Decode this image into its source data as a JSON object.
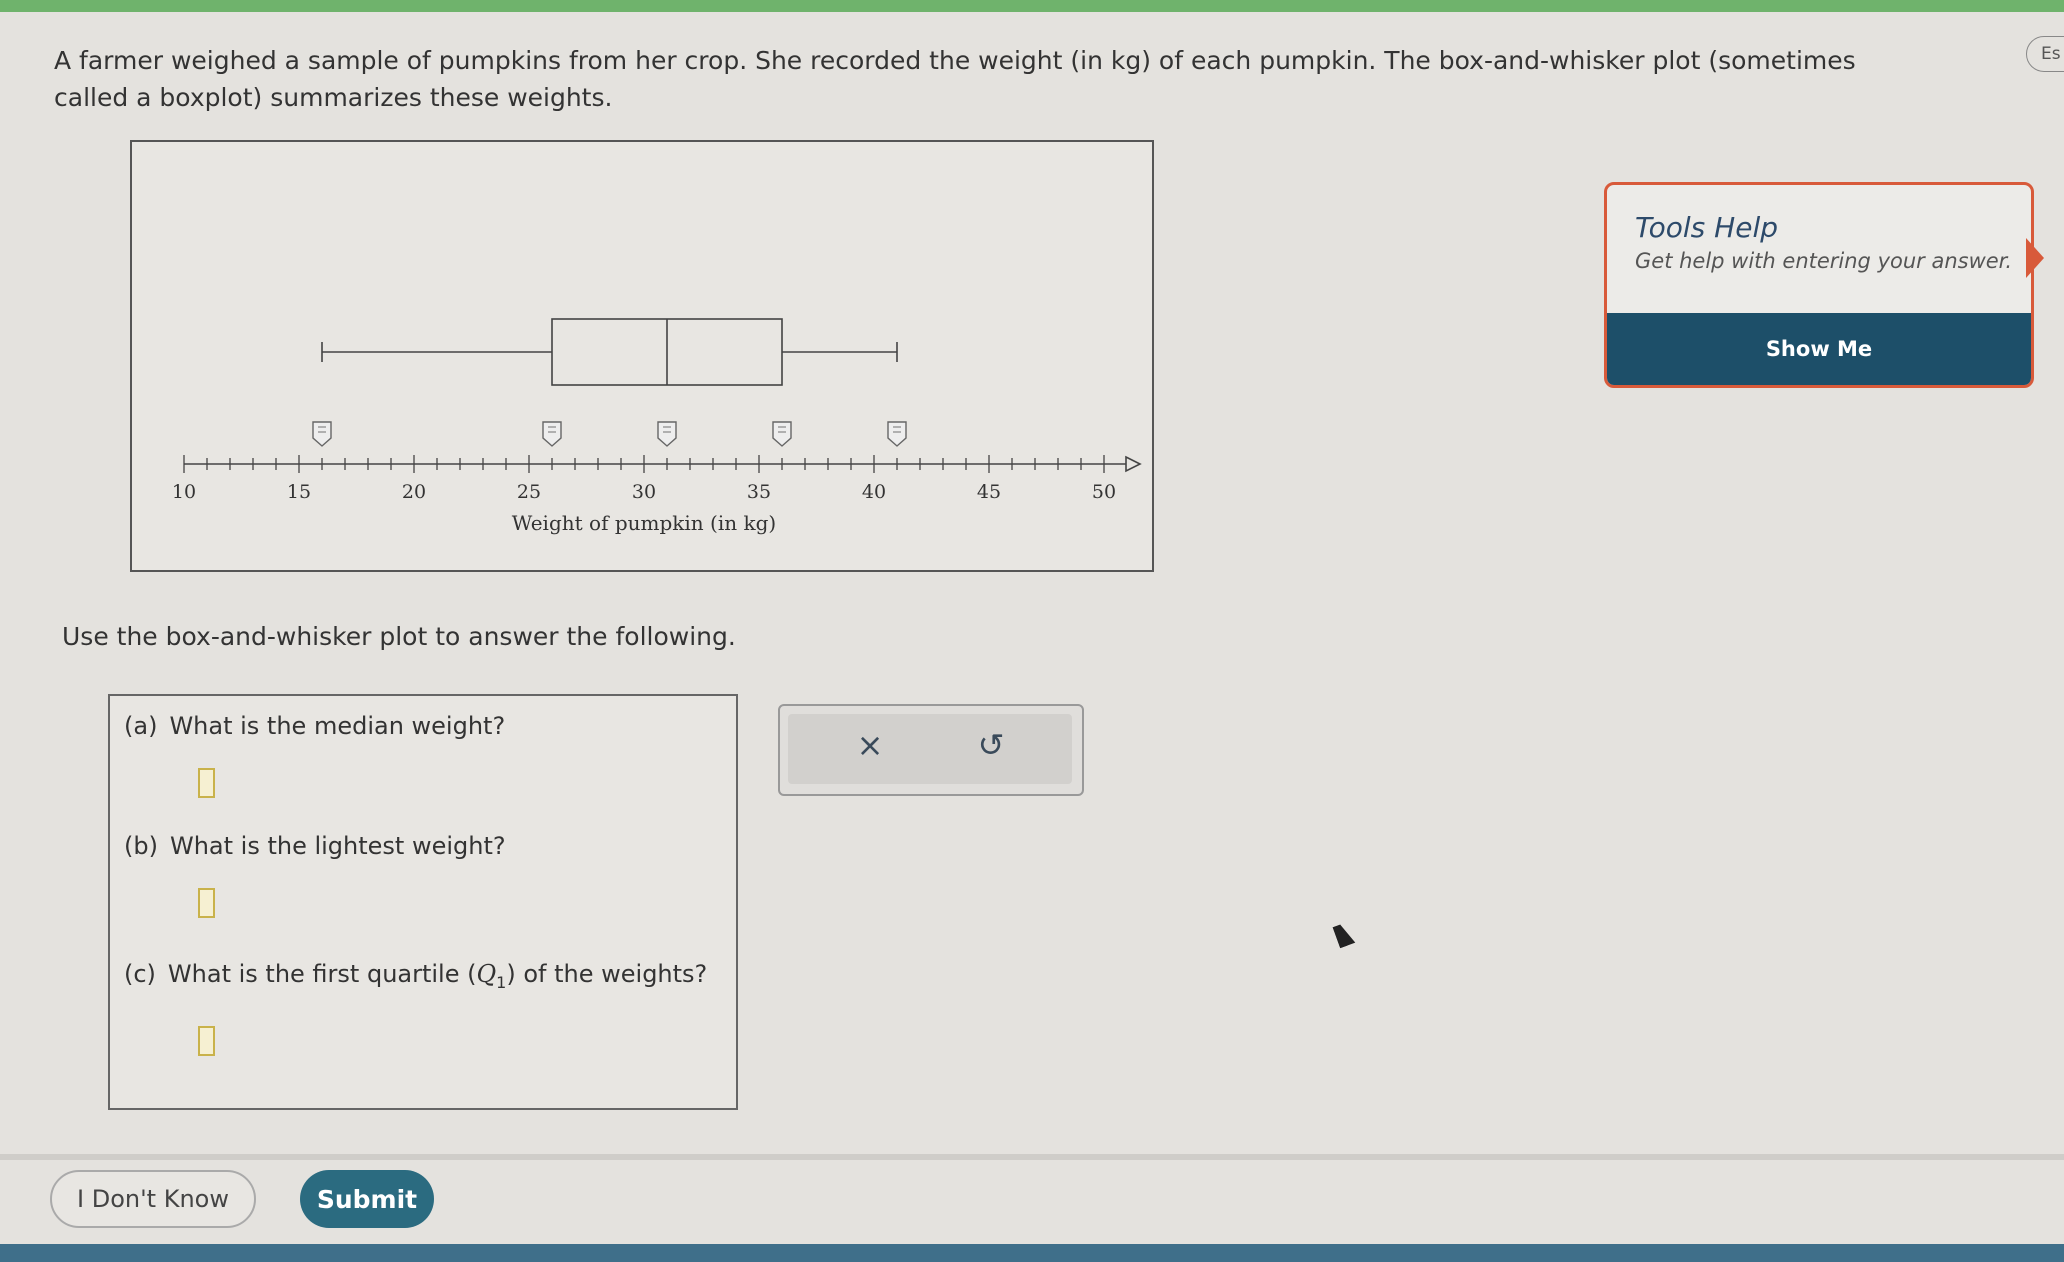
{
  "header": {
    "lang_label": "Es"
  },
  "problem": {
    "intro": "A farmer weighed a sample of pumpkins from her crop. She recorded the weight (in kg) of each pumpkin. The box-and-whisker plot (sometimes called a boxplot) summarizes these weights.",
    "instruction": "Use the box-and-whisker plot to answer the following."
  },
  "chart_data": {
    "type": "boxplot",
    "xlabel": "Weight of pumpkin (in kg)",
    "xlim": [
      10,
      50
    ],
    "ticks": [
      10,
      15,
      20,
      25,
      30,
      35,
      40,
      45,
      50
    ],
    "minor_tick_step": 1,
    "min": 16,
    "q1": 26,
    "median": 31,
    "q3": 36,
    "max": 41,
    "marker_handles_at": [
      16,
      26,
      31,
      36,
      41
    ]
  },
  "questions": [
    {
      "letter": "(a)",
      "text": "What is the median weight?",
      "value": ""
    },
    {
      "letter": "(b)",
      "text": "What is the lightest weight?",
      "value": ""
    },
    {
      "letter": "(c)",
      "text": "What is the first quartile (Q1) of the weights?",
      "text_before": "What is the first quartile (",
      "q_symbol": "Q",
      "q_sub": "1",
      "text_after": ") of the weights?",
      "value": ""
    }
  ],
  "toolbox": {
    "clear_icon": "×",
    "undo_icon": "↺"
  },
  "help": {
    "title": "Tools Help",
    "subtitle": "Get help with entering your answer.",
    "button": "Show Me"
  },
  "footer": {
    "dont_know": "I Don't Know",
    "submit": "Submit"
  },
  "colors": {
    "top_bar": "#6fb36c",
    "submit_bg": "#2b6b80",
    "help_btn_bg": "#1d4f69",
    "help_border": "#d85a3a",
    "answer_box": "#c9b24a"
  }
}
